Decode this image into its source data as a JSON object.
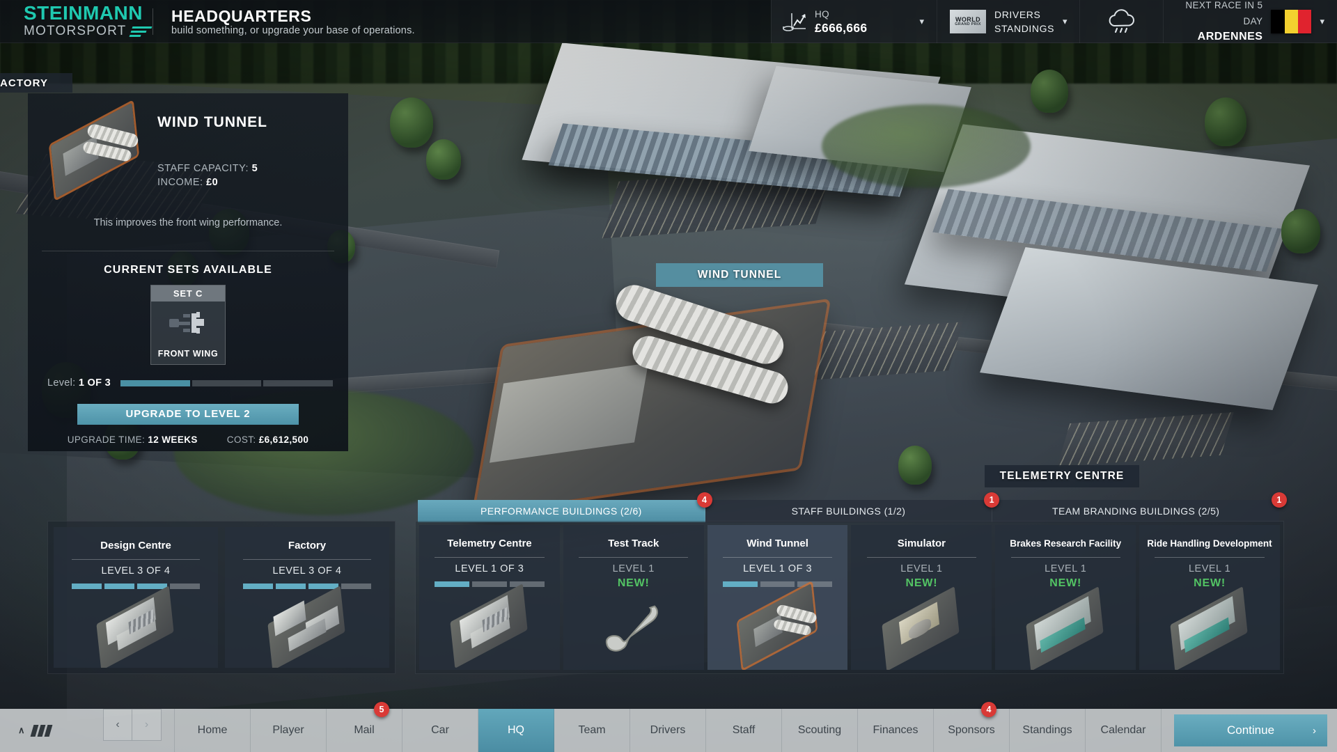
{
  "brand": {
    "name_top": "STEINMANN",
    "name_bottom": "MOTORSPORT"
  },
  "header": {
    "title": "HEADQUARTERS",
    "subtitle": "build something, or upgrade your base of operations."
  },
  "hud": {
    "money": {
      "label": "HQ",
      "value": "£666,666",
      "icon": "finance-chart-icon",
      "chevron": "▾"
    },
    "standings": {
      "logo_top": "WORLD",
      "logo_bottom": "GRAND PRIX",
      "line1": "DRIVERS",
      "line2": "STANDINGS",
      "chevron": "▾"
    },
    "weather": {
      "icon": "rain-cloud-icon"
    },
    "race": {
      "countdown": "NEXT RACE IN 5 DAY",
      "location": "ARDENNES",
      "flag_colors": [
        "#000000",
        "#f3d02f",
        "#e0232e"
      ],
      "chevron": "▾"
    }
  },
  "scene_labels": {
    "factory": "ACTORY",
    "wind_tunnel": "WIND TUNNEL",
    "telemetry": "TELEMETRY CENTRE"
  },
  "info_panel": {
    "title": "WIND TUNNEL",
    "staff_capacity_label": "STAFF CAPACITY:",
    "staff_capacity_value": "5",
    "income_label": "INCOME:",
    "income_value": "£0",
    "description": "This improves the front wing performance.",
    "sets_title": "CURRENT SETS AVAILABLE",
    "set_card": {
      "header": "SET C",
      "footer": "FRONT WING",
      "icon": "front-wing-icon"
    },
    "level_label": "Level:",
    "level_value": "1 OF 3",
    "level_current": 1,
    "level_max": 3,
    "upgrade_button": "UPGRADE TO LEVEL 2",
    "upgrade_time_label": "UPGRADE TIME:",
    "upgrade_time_value": "12 WEEKS",
    "cost_label": "COST:",
    "cost_value": "£6,612,500"
  },
  "tabs": [
    {
      "label": "PERFORMANCE BUILDINGS (2/6)",
      "active": true,
      "badge": "4"
    },
    {
      "label": "STAFF BUILDINGS (1/2)",
      "active": false,
      "badge": "1"
    },
    {
      "label": "TEAM BRANDING BUILDINGS (2/5)",
      "active": false,
      "badge": "1"
    }
  ],
  "owned_buildings": [
    {
      "name": "Design Centre",
      "level_text": "LEVEL 3 OF 4",
      "level": 3,
      "max": 4,
      "new": false,
      "icon": "design-centre-icon"
    },
    {
      "name": "Factory",
      "level_text": "LEVEL 3 OF 4",
      "level": 3,
      "max": 4,
      "new": false,
      "icon": "factory-icon"
    }
  ],
  "available_buildings": [
    {
      "name": "Telemetry Centre",
      "level_text": "LEVEL 1 OF 3",
      "level": 1,
      "max": 3,
      "new": false,
      "selected": false,
      "icon": "telemetry-centre-icon"
    },
    {
      "name": "Test Track",
      "level_text": "LEVEL 1",
      "level": 0,
      "max": 0,
      "new": true,
      "new_label": "NEW!",
      "selected": false,
      "icon": "test-track-icon"
    },
    {
      "name": "Wind Tunnel",
      "level_text": "LEVEL 1 OF 3",
      "level": 1,
      "max": 3,
      "new": false,
      "selected": true,
      "icon": "wind-tunnel-icon"
    },
    {
      "name": "Simulator",
      "level_text": "LEVEL 1",
      "level": 0,
      "max": 0,
      "new": true,
      "new_label": "NEW!",
      "selected": false,
      "icon": "simulator-icon"
    },
    {
      "name": "Brakes Research Facility",
      "level_text": "LEVEL 1",
      "level": 0,
      "max": 0,
      "new": true,
      "new_label": "NEW!",
      "selected": false,
      "icon": "brakes-research-icon"
    },
    {
      "name": "Ride Handling Development",
      "level_text": "LEVEL 1",
      "level": 0,
      "max": 0,
      "new": true,
      "new_label": "NEW!",
      "selected": false,
      "icon": "ride-handling-icon"
    }
  ],
  "bottom_nav": {
    "collapse_caret": "∧",
    "prev_arrow": "‹",
    "next_arrow": "›",
    "items": [
      {
        "label": "Home",
        "active": false,
        "badge": null
      },
      {
        "label": "Player",
        "active": false,
        "badge": null
      },
      {
        "label": "Mail",
        "active": false,
        "badge": "5"
      },
      {
        "label": "Car",
        "active": false,
        "badge": null
      },
      {
        "label": "HQ",
        "active": true,
        "badge": null
      },
      {
        "label": "Team",
        "active": false,
        "badge": null
      },
      {
        "label": "Drivers",
        "active": false,
        "badge": null
      },
      {
        "label": "Staff",
        "active": false,
        "badge": null
      },
      {
        "label": "Scouting",
        "active": false,
        "badge": null
      },
      {
        "label": "Finances",
        "active": false,
        "badge": null
      },
      {
        "label": "Sponsors",
        "active": false,
        "badge": "4"
      },
      {
        "label": "Standings",
        "active": false,
        "badge": null
      },
      {
        "label": "Calendar",
        "active": false,
        "badge": null
      }
    ],
    "continue_label": "Continue",
    "continue_arrow": "›"
  },
  "colors": {
    "accent": "#4e93a8",
    "brand": "#1fc9b0",
    "new_green": "#53c464",
    "badge_red": "#d93a36"
  }
}
